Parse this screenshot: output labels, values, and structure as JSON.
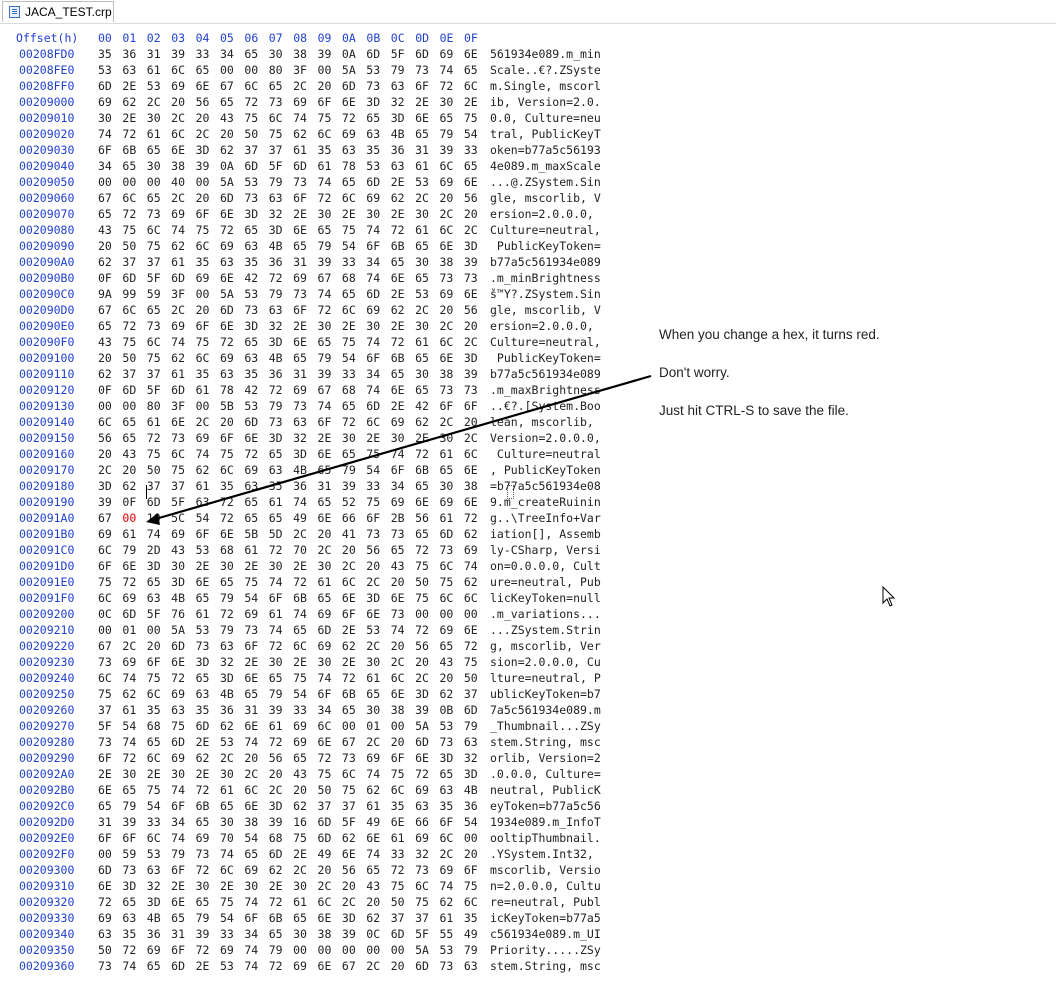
{
  "tab": {
    "title": "JACA_TEST.crp",
    "icon": "hex-file-icon"
  },
  "header": {
    "offset_label": "Offset(h)",
    "columns": [
      "00",
      "01",
      "02",
      "03",
      "04",
      "05",
      "06",
      "07",
      "08",
      "09",
      "0A",
      "0B",
      "0C",
      "0D",
      "0E",
      "0F"
    ]
  },
  "rows": [
    {
      "offset": "00208FD0",
      "bytes": [
        "35",
        "36",
        "31",
        "39",
        "33",
        "34",
        "65",
        "30",
        "38",
        "39",
        "0A",
        "6D",
        "5F",
        "6D",
        "69",
        "6E"
      ],
      "ascii": "561934e089.m_min"
    },
    {
      "offset": "00208FE0",
      "bytes": [
        "53",
        "63",
        "61",
        "6C",
        "65",
        "00",
        "00",
        "80",
        "3F",
        "00",
        "5A",
        "53",
        "79",
        "73",
        "74",
        "65"
      ],
      "ascii": "Scale..€?.ZSyste"
    },
    {
      "offset": "00208FF0",
      "bytes": [
        "6D",
        "2E",
        "53",
        "69",
        "6E",
        "67",
        "6C",
        "65",
        "2C",
        "20",
        "6D",
        "73",
        "63",
        "6F",
        "72",
        "6C"
      ],
      "ascii": "m.Single, mscorl"
    },
    {
      "offset": "00209000",
      "bytes": [
        "69",
        "62",
        "2C",
        "20",
        "56",
        "65",
        "72",
        "73",
        "69",
        "6F",
        "6E",
        "3D",
        "32",
        "2E",
        "30",
        "2E"
      ],
      "ascii": "ib, Version=2.0."
    },
    {
      "offset": "00209010",
      "bytes": [
        "30",
        "2E",
        "30",
        "2C",
        "20",
        "43",
        "75",
        "6C",
        "74",
        "75",
        "72",
        "65",
        "3D",
        "6E",
        "65",
        "75"
      ],
      "ascii": "0.0, Culture=neu"
    },
    {
      "offset": "00209020",
      "bytes": [
        "74",
        "72",
        "61",
        "6C",
        "2C",
        "20",
        "50",
        "75",
        "62",
        "6C",
        "69",
        "63",
        "4B",
        "65",
        "79",
        "54"
      ],
      "ascii": "tral, PublicKeyT"
    },
    {
      "offset": "00209030",
      "bytes": [
        "6F",
        "6B",
        "65",
        "6E",
        "3D",
        "62",
        "37",
        "37",
        "61",
        "35",
        "63",
        "35",
        "36",
        "31",
        "39",
        "33"
      ],
      "ascii": "oken=b77a5c56193"
    },
    {
      "offset": "00209040",
      "bytes": [
        "34",
        "65",
        "30",
        "38",
        "39",
        "0A",
        "6D",
        "5F",
        "6D",
        "61",
        "78",
        "53",
        "63",
        "61",
        "6C",
        "65"
      ],
      "ascii": "4e089.m_maxScale"
    },
    {
      "offset": "00209050",
      "bytes": [
        "00",
        "00",
        "00",
        "40",
        "00",
        "5A",
        "53",
        "79",
        "73",
        "74",
        "65",
        "6D",
        "2E",
        "53",
        "69",
        "6E"
      ],
      "ascii": "...@.ZSystem.Sin"
    },
    {
      "offset": "00209060",
      "bytes": [
        "67",
        "6C",
        "65",
        "2C",
        "20",
        "6D",
        "73",
        "63",
        "6F",
        "72",
        "6C",
        "69",
        "62",
        "2C",
        "20",
        "56"
      ],
      "ascii": "gle, mscorlib, V"
    },
    {
      "offset": "00209070",
      "bytes": [
        "65",
        "72",
        "73",
        "69",
        "6F",
        "6E",
        "3D",
        "32",
        "2E",
        "30",
        "2E",
        "30",
        "2E",
        "30",
        "2C",
        "20"
      ],
      "ascii": "ersion=2.0.0.0, "
    },
    {
      "offset": "00209080",
      "bytes": [
        "43",
        "75",
        "6C",
        "74",
        "75",
        "72",
        "65",
        "3D",
        "6E",
        "65",
        "75",
        "74",
        "72",
        "61",
        "6C",
        "2C"
      ],
      "ascii": "Culture=neutral,"
    },
    {
      "offset": "00209090",
      "bytes": [
        "20",
        "50",
        "75",
        "62",
        "6C",
        "69",
        "63",
        "4B",
        "65",
        "79",
        "54",
        "6F",
        "6B",
        "65",
        "6E",
        "3D"
      ],
      "ascii": " PublicKeyToken="
    },
    {
      "offset": "002090A0",
      "bytes": [
        "62",
        "37",
        "37",
        "61",
        "35",
        "63",
        "35",
        "36",
        "31",
        "39",
        "33",
        "34",
        "65",
        "30",
        "38",
        "39"
      ],
      "ascii": "b77a5c561934e089"
    },
    {
      "offset": "002090B0",
      "bytes": [
        "0F",
        "6D",
        "5F",
        "6D",
        "69",
        "6E",
        "42",
        "72",
        "69",
        "67",
        "68",
        "74",
        "6E",
        "65",
        "73",
        "73"
      ],
      "ascii": ".m_minBrightness"
    },
    {
      "offset": "002090C0",
      "bytes": [
        "9A",
        "99",
        "59",
        "3F",
        "00",
        "5A",
        "53",
        "79",
        "73",
        "74",
        "65",
        "6D",
        "2E",
        "53",
        "69",
        "6E"
      ],
      "ascii": "š™Y?.ZSystem.Sin"
    },
    {
      "offset": "002090D0",
      "bytes": [
        "67",
        "6C",
        "65",
        "2C",
        "20",
        "6D",
        "73",
        "63",
        "6F",
        "72",
        "6C",
        "69",
        "62",
        "2C",
        "20",
        "56"
      ],
      "ascii": "gle, mscorlib, V"
    },
    {
      "offset": "002090E0",
      "bytes": [
        "65",
        "72",
        "73",
        "69",
        "6F",
        "6E",
        "3D",
        "32",
        "2E",
        "30",
        "2E",
        "30",
        "2E",
        "30",
        "2C",
        "20"
      ],
      "ascii": "ersion=2.0.0.0, "
    },
    {
      "offset": "002090F0",
      "bytes": [
        "43",
        "75",
        "6C",
        "74",
        "75",
        "72",
        "65",
        "3D",
        "6E",
        "65",
        "75",
        "74",
        "72",
        "61",
        "6C",
        "2C"
      ],
      "ascii": "Culture=neutral,"
    },
    {
      "offset": "00209100",
      "bytes": [
        "20",
        "50",
        "75",
        "62",
        "6C",
        "69",
        "63",
        "4B",
        "65",
        "79",
        "54",
        "6F",
        "6B",
        "65",
        "6E",
        "3D"
      ],
      "ascii": " PublicKeyToken="
    },
    {
      "offset": "00209110",
      "bytes": [
        "62",
        "37",
        "37",
        "61",
        "35",
        "63",
        "35",
        "36",
        "31",
        "39",
        "33",
        "34",
        "65",
        "30",
        "38",
        "39"
      ],
      "ascii": "b77a5c561934e089"
    },
    {
      "offset": "00209120",
      "bytes": [
        "0F",
        "6D",
        "5F",
        "6D",
        "61",
        "78",
        "42",
        "72",
        "69",
        "67",
        "68",
        "74",
        "6E",
        "65",
        "73",
        "73"
      ],
      "ascii": ".m_maxBrightness"
    },
    {
      "offset": "00209130",
      "bytes": [
        "00",
        "00",
        "80",
        "3F",
        "00",
        "5B",
        "53",
        "79",
        "73",
        "74",
        "65",
        "6D",
        "2E",
        "42",
        "6F",
        "6F"
      ],
      "ascii": "..€?.[System.Boo"
    },
    {
      "offset": "00209140",
      "bytes": [
        "6C",
        "65",
        "61",
        "6E",
        "2C",
        "20",
        "6D",
        "73",
        "63",
        "6F",
        "72",
        "6C",
        "69",
        "62",
        "2C",
        "20"
      ],
      "ascii": "lean, mscorlib, "
    },
    {
      "offset": "00209150",
      "bytes": [
        "56",
        "65",
        "72",
        "73",
        "69",
        "6F",
        "6E",
        "3D",
        "32",
        "2E",
        "30",
        "2E",
        "30",
        "2E",
        "30",
        "2C"
      ],
      "ascii": "Version=2.0.0.0,"
    },
    {
      "offset": "00209160",
      "bytes": [
        "20",
        "43",
        "75",
        "6C",
        "74",
        "75",
        "72",
        "65",
        "3D",
        "6E",
        "65",
        "75",
        "74",
        "72",
        "61",
        "6C"
      ],
      "ascii": " Culture=neutral"
    },
    {
      "offset": "00209170",
      "bytes": [
        "2C",
        "20",
        "50",
        "75",
        "62",
        "6C",
        "69",
        "63",
        "4B",
        "65",
        "79",
        "54",
        "6F",
        "6B",
        "65",
        "6E"
      ],
      "ascii": ", PublicKeyToken"
    },
    {
      "offset": "00209180",
      "bytes": [
        "3D",
        "62",
        "37",
        "37",
        "61",
        "35",
        "63",
        "35",
        "36",
        "31",
        "39",
        "33",
        "34",
        "65",
        "30",
        "38"
      ],
      "ascii": "=b77a5c561934e08"
    },
    {
      "offset": "00209190",
      "bytes": [
        "39",
        "0F",
        "6D",
        "5F",
        "63",
        "72",
        "65",
        "61",
        "74",
        "65",
        "52",
        "75",
        "69",
        "6E",
        "69",
        "6E"
      ],
      "ascii": "9.m_createRuinin"
    },
    {
      "offset": "002091A0",
      "bytes": [
        "67",
        "00",
        "10",
        "5C",
        "54",
        "72",
        "65",
        "65",
        "49",
        "6E",
        "66",
        "6F",
        "2B",
        "56",
        "61",
        "72"
      ],
      "ascii": "g..\\TreeInfo+Var",
      "changed": [
        1
      ]
    },
    {
      "offset": "002091B0",
      "bytes": [
        "69",
        "61",
        "74",
        "69",
        "6F",
        "6E",
        "5B",
        "5D",
        "2C",
        "20",
        "41",
        "73",
        "73",
        "65",
        "6D",
        "62"
      ],
      "ascii": "iation[], Assemb"
    },
    {
      "offset": "002091C0",
      "bytes": [
        "6C",
        "79",
        "2D",
        "43",
        "53",
        "68",
        "61",
        "72",
        "70",
        "2C",
        "20",
        "56",
        "65",
        "72",
        "73",
        "69"
      ],
      "ascii": "ly-CSharp, Versi"
    },
    {
      "offset": "002091D0",
      "bytes": [
        "6F",
        "6E",
        "3D",
        "30",
        "2E",
        "30",
        "2E",
        "30",
        "2E",
        "30",
        "2C",
        "20",
        "43",
        "75",
        "6C",
        "74"
      ],
      "ascii": "on=0.0.0.0, Cult"
    },
    {
      "offset": "002091E0",
      "bytes": [
        "75",
        "72",
        "65",
        "3D",
        "6E",
        "65",
        "75",
        "74",
        "72",
        "61",
        "6C",
        "2C",
        "20",
        "50",
        "75",
        "62"
      ],
      "ascii": "ure=neutral, Pub"
    },
    {
      "offset": "002091F0",
      "bytes": [
        "6C",
        "69",
        "63",
        "4B",
        "65",
        "79",
        "54",
        "6F",
        "6B",
        "65",
        "6E",
        "3D",
        "6E",
        "75",
        "6C",
        "6C"
      ],
      "ascii": "licKeyToken=null"
    },
    {
      "offset": "00209200",
      "bytes": [
        "0C",
        "6D",
        "5F",
        "76",
        "61",
        "72",
        "69",
        "61",
        "74",
        "69",
        "6F",
        "6E",
        "73",
        "00",
        "00",
        "00"
      ],
      "ascii": ".m_variations..."
    },
    {
      "offset": "00209210",
      "bytes": [
        "00",
        "01",
        "00",
        "5A",
        "53",
        "79",
        "73",
        "74",
        "65",
        "6D",
        "2E",
        "53",
        "74",
        "72",
        "69",
        "6E"
      ],
      "ascii": "...ZSystem.Strin"
    },
    {
      "offset": "00209220",
      "bytes": [
        "67",
        "2C",
        "20",
        "6D",
        "73",
        "63",
        "6F",
        "72",
        "6C",
        "69",
        "62",
        "2C",
        "20",
        "56",
        "65",
        "72"
      ],
      "ascii": "g, mscorlib, Ver"
    },
    {
      "offset": "00209230",
      "bytes": [
        "73",
        "69",
        "6F",
        "6E",
        "3D",
        "32",
        "2E",
        "30",
        "2E",
        "30",
        "2E",
        "30",
        "2C",
        "20",
        "43",
        "75"
      ],
      "ascii": "sion=2.0.0.0, Cu"
    },
    {
      "offset": "00209240",
      "bytes": [
        "6C",
        "74",
        "75",
        "72",
        "65",
        "3D",
        "6E",
        "65",
        "75",
        "74",
        "72",
        "61",
        "6C",
        "2C",
        "20",
        "50"
      ],
      "ascii": "lture=neutral, P"
    },
    {
      "offset": "00209250",
      "bytes": [
        "75",
        "62",
        "6C",
        "69",
        "63",
        "4B",
        "65",
        "79",
        "54",
        "6F",
        "6B",
        "65",
        "6E",
        "3D",
        "62",
        "37"
      ],
      "ascii": "ublicKeyToken=b7"
    },
    {
      "offset": "00209260",
      "bytes": [
        "37",
        "61",
        "35",
        "63",
        "35",
        "36",
        "31",
        "39",
        "33",
        "34",
        "65",
        "30",
        "38",
        "39",
        "0B",
        "6D"
      ],
      "ascii": "7a5c561934e089.m"
    },
    {
      "offset": "00209270",
      "bytes": [
        "5F",
        "54",
        "68",
        "75",
        "6D",
        "62",
        "6E",
        "61",
        "69",
        "6C",
        "00",
        "01",
        "00",
        "5A",
        "53",
        "79"
      ],
      "ascii": "_Thumbnail...ZSy"
    },
    {
      "offset": "00209280",
      "bytes": [
        "73",
        "74",
        "65",
        "6D",
        "2E",
        "53",
        "74",
        "72",
        "69",
        "6E",
        "67",
        "2C",
        "20",
        "6D",
        "73",
        "63"
      ],
      "ascii": "stem.String, msc"
    },
    {
      "offset": "00209290",
      "bytes": [
        "6F",
        "72",
        "6C",
        "69",
        "62",
        "2C",
        "20",
        "56",
        "65",
        "72",
        "73",
        "69",
        "6F",
        "6E",
        "3D",
        "32"
      ],
      "ascii": "orlib, Version=2"
    },
    {
      "offset": "002092A0",
      "bytes": [
        "2E",
        "30",
        "2E",
        "30",
        "2E",
        "30",
        "2C",
        "20",
        "43",
        "75",
        "6C",
        "74",
        "75",
        "72",
        "65",
        "3D"
      ],
      "ascii": ".0.0.0, Culture="
    },
    {
      "offset": "002092B0",
      "bytes": [
        "6E",
        "65",
        "75",
        "74",
        "72",
        "61",
        "6C",
        "2C",
        "20",
        "50",
        "75",
        "62",
        "6C",
        "69",
        "63",
        "4B"
      ],
      "ascii": "neutral, PublicK"
    },
    {
      "offset": "002092C0",
      "bytes": [
        "65",
        "79",
        "54",
        "6F",
        "6B",
        "65",
        "6E",
        "3D",
        "62",
        "37",
        "37",
        "61",
        "35",
        "63",
        "35",
        "36"
      ],
      "ascii": "eyToken=b77a5c56"
    },
    {
      "offset": "002092D0",
      "bytes": [
        "31",
        "39",
        "33",
        "34",
        "65",
        "30",
        "38",
        "39",
        "16",
        "6D",
        "5F",
        "49",
        "6E",
        "66",
        "6F",
        "54"
      ],
      "ascii": "1934e089.m_InfoT"
    },
    {
      "offset": "002092E0",
      "bytes": [
        "6F",
        "6F",
        "6C",
        "74",
        "69",
        "70",
        "54",
        "68",
        "75",
        "6D",
        "62",
        "6E",
        "61",
        "69",
        "6C",
        "00"
      ],
      "ascii": "ooltipThumbnail."
    },
    {
      "offset": "002092F0",
      "bytes": [
        "00",
        "59",
        "53",
        "79",
        "73",
        "74",
        "65",
        "6D",
        "2E",
        "49",
        "6E",
        "74",
        "33",
        "32",
        "2C",
        "20"
      ],
      "ascii": ".YSystem.Int32, "
    },
    {
      "offset": "00209300",
      "bytes": [
        "6D",
        "73",
        "63",
        "6F",
        "72",
        "6C",
        "69",
        "62",
        "2C",
        "20",
        "56",
        "65",
        "72",
        "73",
        "69",
        "6F"
      ],
      "ascii": "mscorlib, Versio"
    },
    {
      "offset": "00209310",
      "bytes": [
        "6E",
        "3D",
        "32",
        "2E",
        "30",
        "2E",
        "30",
        "2E",
        "30",
        "2C",
        "20",
        "43",
        "75",
        "6C",
        "74",
        "75"
      ],
      "ascii": "n=2.0.0.0, Cultu"
    },
    {
      "offset": "00209320",
      "bytes": [
        "72",
        "65",
        "3D",
        "6E",
        "65",
        "75",
        "74",
        "72",
        "61",
        "6C",
        "2C",
        "20",
        "50",
        "75",
        "62",
        "6C"
      ],
      "ascii": "re=neutral, Publ"
    },
    {
      "offset": "00209330",
      "bytes": [
        "69",
        "63",
        "4B",
        "65",
        "79",
        "54",
        "6F",
        "6B",
        "65",
        "6E",
        "3D",
        "62",
        "37",
        "37",
        "61",
        "35"
      ],
      "ascii": "icKeyToken=b77a5"
    },
    {
      "offset": "00209340",
      "bytes": [
        "63",
        "35",
        "36",
        "31",
        "39",
        "33",
        "34",
        "65",
        "30",
        "38",
        "39",
        "0C",
        "6D",
        "5F",
        "55",
        "49"
      ],
      "ascii": "c561934e089.m_UI"
    },
    {
      "offset": "00209350",
      "bytes": [
        "50",
        "72",
        "69",
        "6F",
        "72",
        "69",
        "74",
        "79",
        "00",
        "00",
        "00",
        "00",
        "00",
        "5A",
        "53",
        "79"
      ],
      "ascii": "Priority.....ZSy"
    },
    {
      "offset": "00209360",
      "bytes": [
        "73",
        "74",
        "65",
        "6D",
        "2E",
        "53",
        "74",
        "72",
        "69",
        "6E",
        "67",
        "2C",
        "20",
        "6D",
        "73",
        "63"
      ],
      "ascii": "stem.String, msc"
    }
  ],
  "annotations": {
    "line1": "When you change a hex, it turns red.",
    "line2": "Don't worry.",
    "line3": "Just hit CTRL-S to save the file."
  },
  "colors": {
    "offset": "#1f3fd0",
    "changed": "#e00000",
    "text": "#222222"
  }
}
